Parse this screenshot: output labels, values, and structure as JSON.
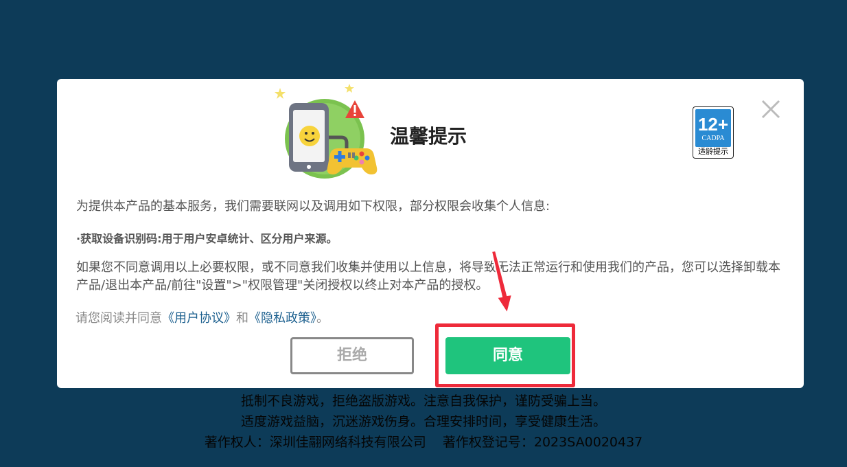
{
  "dialog": {
    "title": "温馨提示",
    "age_rating": {
      "age": "12+",
      "org": "CADPA",
      "tip": "适龄提示"
    },
    "intro": "为提供本产品的基本服务，我们需要联网以及调用如下权限，部分权限会收集个人信息:",
    "permission": "·获取设备识别码:用于用户安卓统计、区分用户来源。",
    "notice": "如果您不同意调用以上必要权限，或不同意我们收集并使用以上信息，将导致无法正常运行和使用我们的产品，您可以选择卸载本产品/退出本产品/前往\"设置\">\"权限管理\"关闭授权以终止对本产品的授权。",
    "agreement": {
      "prefix": "请您阅读并同意",
      "user_agreement": "《用户协议》",
      "and": "和",
      "privacy_policy": "《隐私政策》",
      "suffix": "。"
    },
    "reject_label": "拒绝",
    "agree_label": "同意"
  },
  "footer": {
    "line1": "抵制不良游戏，拒绝盗版游戏。注意自我保护，谨防受骗上当。",
    "line2": "适度游戏益脑，沉迷游戏伤身。合理安排时间，享受健康生活。",
    "line3": "著作权人：深圳佳翮网络科技有限公司    著作权登记号：2023SA0020437"
  },
  "colors": {
    "background": "#0d3b58",
    "agree_button": "#1fc47d",
    "link": "#1b5f8e",
    "annotation": "#ee2a3a"
  },
  "icons": [
    "game-controller-illustration",
    "close-icon",
    "age-rating-badge",
    "annotation-arrow"
  ]
}
